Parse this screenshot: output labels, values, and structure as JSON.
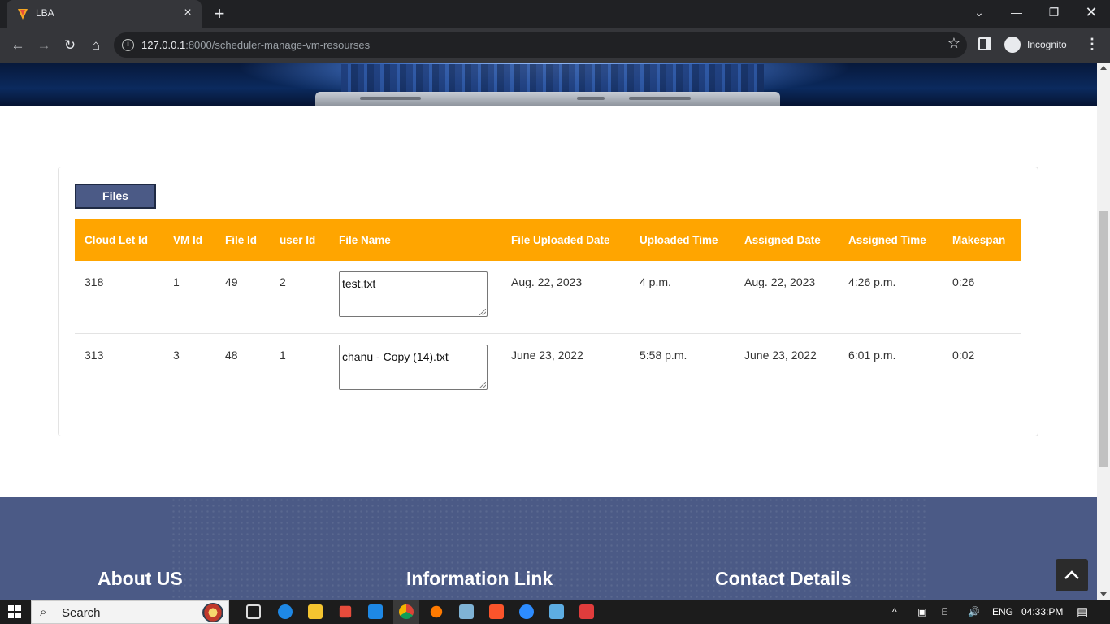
{
  "browser": {
    "tab_title": "LBA",
    "url_host": "127.0.0.1",
    "url_rest": ":8000/scheduler-manage-vm-resourses",
    "profile_label": "Incognito"
  },
  "page": {
    "files_tab_label": "Files",
    "table": {
      "headers": [
        "Cloud Let Id",
        "VM Id",
        "File Id",
        "user Id",
        "File Name",
        "File Uploaded Date",
        "Uploaded Time",
        "Assigned Date",
        "Assigned Time",
        "Makespan"
      ],
      "rows": [
        {
          "cloudlet_id": "318",
          "vm_id": "1",
          "file_id": "49",
          "user_id": "2",
          "file_name": "test.txt",
          "uploaded_date": "Aug. 22, 2023",
          "uploaded_time": "4 p.m.",
          "assigned_date": "Aug. 22, 2023",
          "assigned_time": "4:26 p.m.",
          "makespan": "0:26"
        },
        {
          "cloudlet_id": "313",
          "vm_id": "3",
          "file_id": "48",
          "user_id": "1",
          "file_name": "chanu - Copy (14).txt",
          "uploaded_date": "June 23, 2022",
          "uploaded_time": "5:58 p.m.",
          "assigned_date": "June 23, 2022",
          "assigned_time": "6:01 p.m.",
          "makespan": "0:02"
        }
      ]
    },
    "footer": {
      "about_heading": "About US",
      "info_heading": "Information Link",
      "contact_heading": "Contact Details"
    }
  },
  "taskbar": {
    "search_placeholder": "Search",
    "language": "ENG",
    "clock": "04:33:PM"
  },
  "colors": {
    "table_header": "#ffa500",
    "footer_bg": "#4b5a86",
    "files_tab_bg": "#4b5a86"
  }
}
